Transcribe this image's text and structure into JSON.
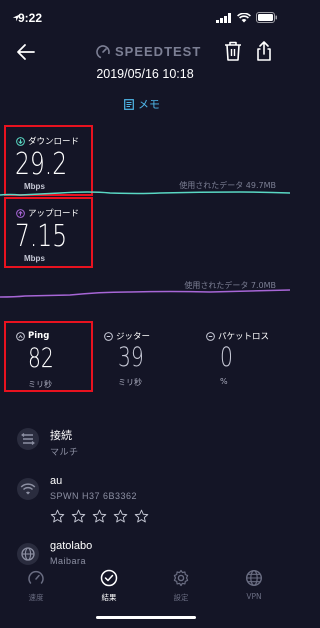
{
  "status_bar": {
    "time": "9:22"
  },
  "header": {
    "app_title": "SPEEDTEST"
  },
  "test": {
    "datetime": "2019/05/16 10:18",
    "memo_label": "メモ"
  },
  "download": {
    "label": "ダウンロード",
    "value": "29.2",
    "unit": "Mbps",
    "data_used": "使用されたデータ 49.7MB"
  },
  "upload": {
    "label": "アップロード",
    "value": "7.15",
    "unit": "Mbps",
    "data_used": "使用されたデータ 7.0MB"
  },
  "ping": {
    "label": "Ping",
    "value": "82",
    "unit": "ミリ秒"
  },
  "jitter": {
    "label": "ジッター",
    "value": "39",
    "unit": "ミリ秒"
  },
  "packet_loss": {
    "label": "パケットロス",
    "value": "0",
    "unit": "%"
  },
  "connection": {
    "title": "接続",
    "detail": "マルチ"
  },
  "carrier": {
    "name": "au",
    "detail": "SPWN H37 6B3362",
    "rating": 0,
    "rating_max": 5
  },
  "server": {
    "name": "gatolabo",
    "location": "Maibara"
  },
  "tabs": [
    {
      "label": "速度",
      "icon": "speed-gauge-icon",
      "active": false
    },
    {
      "label": "結果",
      "icon": "check-circle-icon",
      "active": true
    },
    {
      "label": "設定",
      "icon": "gear-icon",
      "active": false
    },
    {
      "label": "VPN",
      "icon": "globe-icon",
      "active": false
    }
  ],
  "colors": {
    "background": "#141526",
    "highlight_box": "#e8121f",
    "download_wave": "#5ad8c4",
    "upload_wave": "#a766d6",
    "memo_link": "#4fb6e8"
  }
}
